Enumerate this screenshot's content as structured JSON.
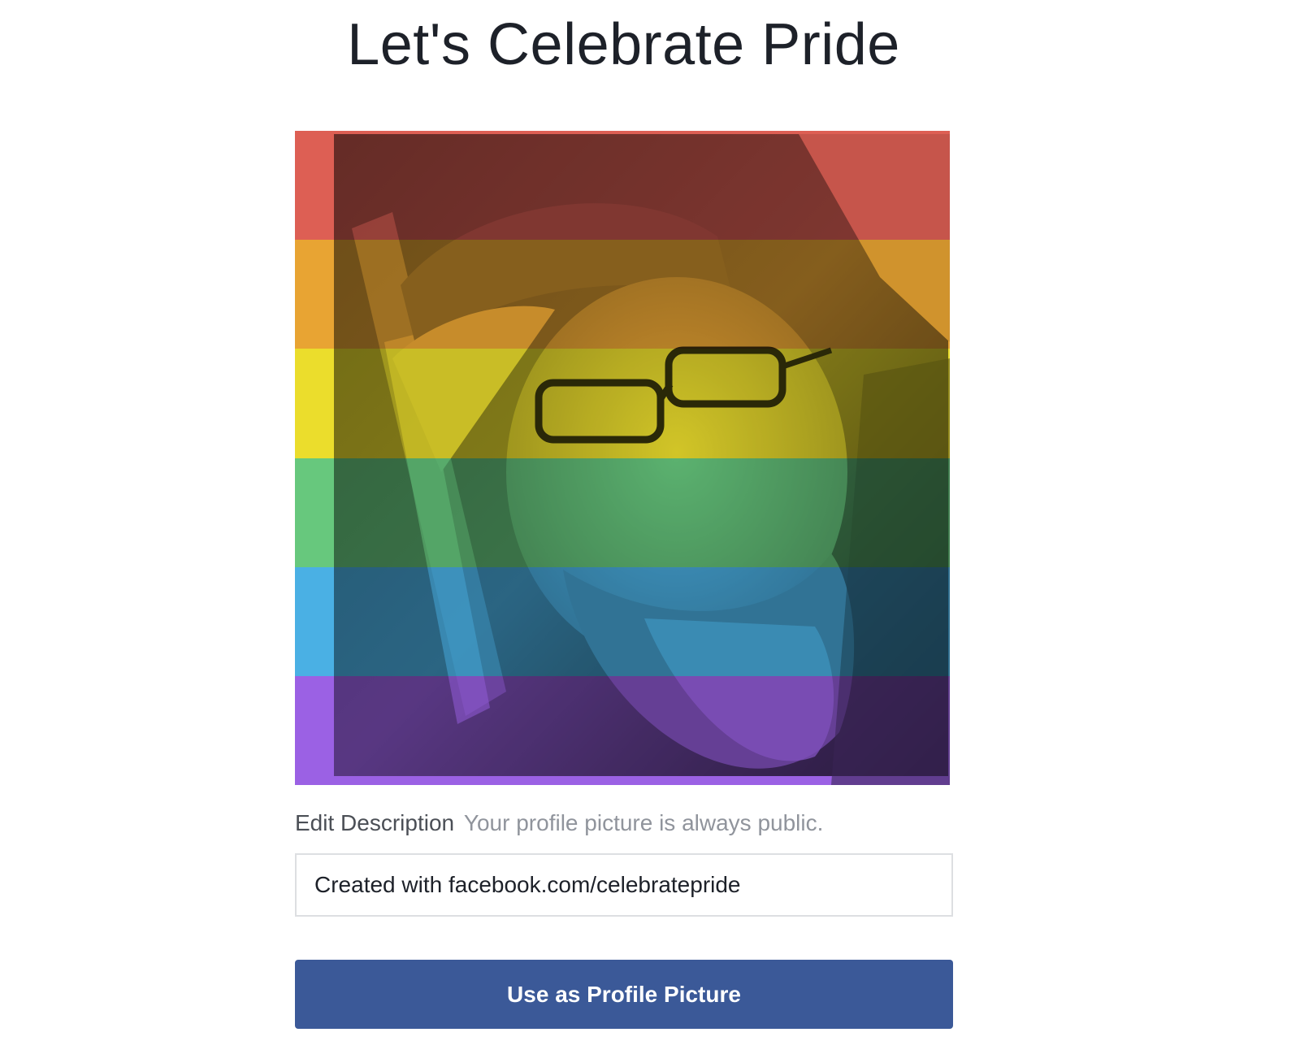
{
  "page": {
    "title": "Let's Celebrate Pride"
  },
  "profile_photo": {
    "overlay": "rainbow-pride-filter",
    "stripe_colors": [
      "#e8574a",
      "#f5a623",
      "#f8e71c",
      "#5fd07a",
      "#3fb4f0",
      "#9b59f0"
    ]
  },
  "description": {
    "label": "Edit Description",
    "hint": "Your profile picture is always public.",
    "value": "Created with facebook.com/celebratepride"
  },
  "actions": {
    "primary_label": "Use as Profile Picture",
    "primary_color": "#3b5998"
  }
}
